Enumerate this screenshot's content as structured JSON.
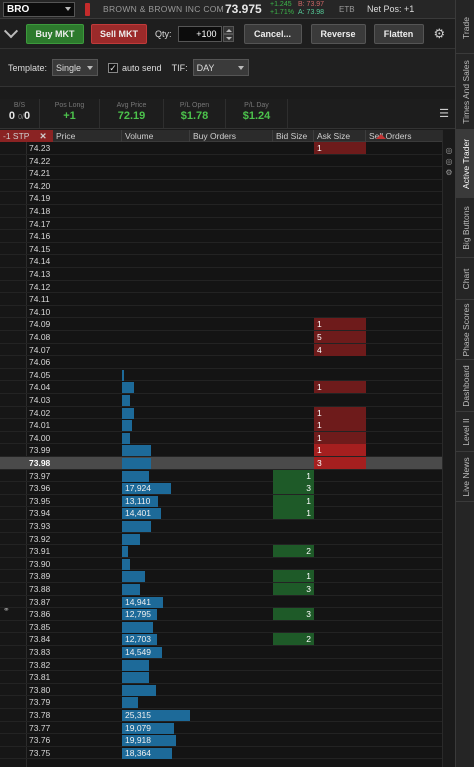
{
  "header": {
    "symbol": "BRO",
    "company": "BROWN & BROWN INC COM",
    "last": "73.975",
    "change": "+1.245",
    "change_pct": "+1.71%",
    "bid": "B: 73.97",
    "ask": "A: 73.98",
    "exchange": "ETB",
    "net_pos": "Net Pos: +1"
  },
  "actions": {
    "buy": "Buy MKT",
    "sell": "Sell MKT",
    "qty_label": "Qty:",
    "qty_value": "+100",
    "cancel": "Cancel...",
    "reverse": "Reverse",
    "flatten": "Flatten"
  },
  "template": {
    "label": "Template:",
    "value": "Single",
    "autosend": "auto send",
    "tif_label": "TIF:",
    "tif_value": "DAY"
  },
  "position": {
    "bs_h": "B/S",
    "bs_v": "0",
    "bs_sep": "0 / 0",
    "long_h": "Pos Long",
    "long_v": "+1",
    "avg_h": "Avg Price",
    "avg_v": "72.19",
    "plo_h": "P/L Open",
    "plo_v": "$1.78",
    "pld_h": "P/L Day",
    "pld_v": "$1.24"
  },
  "ladder_headers": {
    "stp": "-1 STP",
    "price": "Price",
    "volume": "Volume",
    "buy_orders": "Buy Orders",
    "bid_size": "Bid Size",
    "ask_size": "Ask Size",
    "sell_orders": "Sell Orders"
  },
  "side_tabs": [
    "Trade",
    "Times And Sales",
    "Active Trader",
    "Big Buttons",
    "Chart",
    "Phase Scores",
    "Dashboard",
    "Level II",
    "Live News"
  ],
  "colors": {
    "buy": "#2d7a2d",
    "sell": "#9b2a2a",
    "volume_bar": "#1d6a99",
    "bid_fill": "#1e5a28",
    "ask_fill": "#6e1b1b"
  },
  "ladder": [
    {
      "price": "74.23",
      "ask": "1"
    },
    {
      "price": "74.22"
    },
    {
      "price": "74.21"
    },
    {
      "price": "74.20"
    },
    {
      "price": "74.19"
    },
    {
      "price": "74.18"
    },
    {
      "price": "74.17"
    },
    {
      "price": "74.16"
    },
    {
      "price": "74.15"
    },
    {
      "price": "74.14"
    },
    {
      "price": "74.13"
    },
    {
      "price": "74.12"
    },
    {
      "price": "74.11"
    },
    {
      "price": "74.10"
    },
    {
      "price": "74.09",
      "ask": "1"
    },
    {
      "price": "74.08",
      "ask": "5"
    },
    {
      "price": "74.07",
      "ask": "4"
    },
    {
      "price": "74.06"
    },
    {
      "price": "74.05",
      "vol_frac": 0.03
    },
    {
      "price": "74.04",
      "vol_frac": 0.18,
      "ask": "1"
    },
    {
      "price": "74.03",
      "vol_frac": 0.12
    },
    {
      "price": "74.02",
      "vol_frac": 0.18,
      "ask": "1"
    },
    {
      "price": "74.01",
      "vol_frac": 0.15,
      "ask": "1"
    },
    {
      "price": "74.00",
      "vol_frac": 0.12,
      "ask": "1"
    },
    {
      "price": "73.99",
      "vol_frac": 0.42,
      "ask": "1"
    },
    {
      "price": "73.98",
      "vol_frac": 0.42,
      "ask": "3",
      "current": true
    },
    {
      "price": "73.97",
      "vol_frac": 0.4,
      "bid": "1"
    },
    {
      "price": "73.96",
      "vol": "17,924",
      "vol_frac": 0.72,
      "bid": "3"
    },
    {
      "price": "73.95",
      "vol": "13,110",
      "vol_frac": 0.53,
      "bid": "1"
    },
    {
      "price": "73.94",
      "vol": "14,401",
      "vol_frac": 0.58,
      "bid": "1"
    },
    {
      "price": "73.93",
      "vol_frac": 0.42
    },
    {
      "price": "73.92",
      "vol_frac": 0.27
    },
    {
      "price": "73.91",
      "vol_frac": 0.09,
      "bid": "2"
    },
    {
      "price": "73.90",
      "vol_frac": 0.12
    },
    {
      "price": "73.89",
      "vol_frac": 0.34,
      "bid": "1"
    },
    {
      "price": "73.88",
      "vol_frac": 0.27,
      "bid": "3"
    },
    {
      "price": "73.87",
      "vol": "14,941",
      "vol_frac": 0.6
    },
    {
      "price": "73.86",
      "vol": "12,795",
      "vol_frac": 0.52,
      "bid": "3"
    },
    {
      "price": "73.85",
      "vol_frac": 0.45
    },
    {
      "price": "73.84",
      "vol": "12,703",
      "vol_frac": 0.51,
      "bid": "2"
    },
    {
      "price": "73.83",
      "vol": "14,549",
      "vol_frac": 0.59
    },
    {
      "price": "73.82",
      "vol_frac": 0.4
    },
    {
      "price": "73.81",
      "vol_frac": 0.4
    },
    {
      "price": "73.80",
      "vol_frac": 0.5
    },
    {
      "price": "73.79",
      "vol_frac": 0.24
    },
    {
      "price": "73.78",
      "vol": "25,315",
      "vol_frac": 1.0
    },
    {
      "price": "73.77",
      "vol": "19,079",
      "vol_frac": 0.76
    },
    {
      "price": "73.76",
      "vol": "19,918",
      "vol_frac": 0.79
    },
    {
      "price": "73.75",
      "vol": "18,364",
      "vol_frac": 0.73
    }
  ]
}
